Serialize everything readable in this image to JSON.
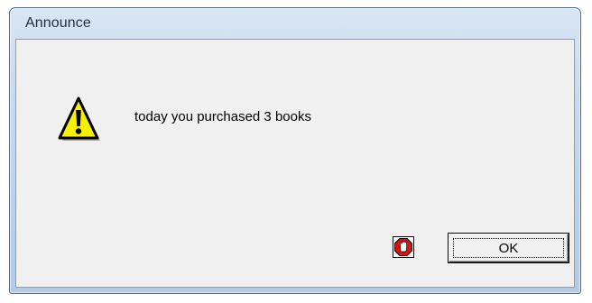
{
  "window": {
    "title": "Announce"
  },
  "dialog": {
    "message": "today you purchased 3 books",
    "icon": "warning-icon",
    "ok_label": "OK",
    "stop_icon": "stop-hand-icon"
  },
  "colors": {
    "warning_yellow": "#f7f000",
    "stop_red": "#e01010",
    "client_background": "#f0f0f0"
  }
}
